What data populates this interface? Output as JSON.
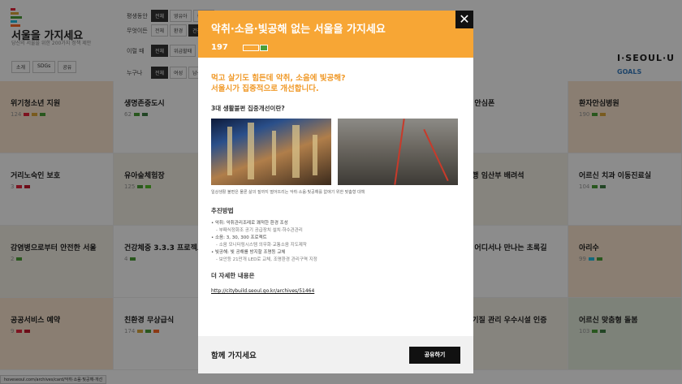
{
  "sidebar": {
    "title": "서울을 가지세요",
    "subtitle": "당신의 서울을 위한 200가지 정책 제안",
    "buttons": [
      "소개",
      "SDGs",
      "공유"
    ]
  },
  "filters": {
    "rows": [
      {
        "label": "평생동안",
        "chips": [
          "전체",
          "영유아",
          "청소년"
        ]
      },
      {
        "label": "무엇이든",
        "chips": [
          "전체",
          "환경",
          "건강"
        ]
      },
      {
        "label": "이럴 때",
        "chips": [
          "전체",
          "위급할때"
        ]
      },
      {
        "label": "누구나",
        "chips": [
          "전체",
          "여성",
          "남성"
        ]
      }
    ]
  },
  "brand": {
    "logo": "I·SEOUL·U",
    "goals": "GOALS"
  },
  "grid_cards": [
    {
      "title": "위기청소년 지원",
      "num": "124"
    },
    {
      "title": "생명존중도시",
      "num": "62"
    },
    {
      "title": "의 안심폰",
      "num": ""
    },
    {
      "title": "환자안심병원",
      "num": "190"
    },
    {
      "title": "거리노숙인 보호",
      "num": "3"
    },
    {
      "title": "유아숲체험장",
      "num": "125"
    },
    {
      "title": "보행 임산부 배려석",
      "num": ""
    },
    {
      "title": "어르신 치과 이동진료실",
      "num": "104"
    },
    {
      "title": "감염병으로부터 안전한 서울",
      "num": "2"
    },
    {
      "title": "건강체중 3.3.3 프로젝트",
      "num": "4"
    },
    {
      "title": "이 어디서나 만나는 초록길",
      "num": ""
    },
    {
      "title": "아리수",
      "num": "99"
    },
    {
      "title": "공공서비스 예약",
      "num": "9"
    },
    {
      "title": "친환경 무상급식",
      "num": "174"
    },
    {
      "title": "공기질 관리 우수시설 인증",
      "num": ""
    },
    {
      "title": "어르신 맞춤형 돌봄",
      "num": "103"
    }
  ],
  "status_url": "hoveseoul.com/archives/card/악취·소음·빛공해-개선",
  "modal": {
    "title": "악취·소음·빛공해 없는 서울을 가지세요",
    "number": "197",
    "lead_line1": "먹고 살기도 힘든데 악취, 소음에 빛공해?",
    "lead_line2": "서울시가 집중적으로 개선합니다.",
    "section1": "3대 생활불편 집중개선이란?",
    "caption": "일상생활 불편은 물론 삶의 질까지 떨어뜨리는 악취·소음·빛공해를 없애기 위한 맞춤형 대책",
    "section2": "추진방법",
    "methods": [
      {
        "item": "• 악취: 악취관리조례로 쾌적한 환경 조성",
        "sub": "- 부패식정화조 공기 공급장치 설치·하수관관리"
      },
      {
        "item": "• 소음: 3, 30, 300 프로젝트",
        "sub": "- 소음 모니터링시스템 의무화·교통소음 지도제작"
      },
      {
        "item": "• 빛공해: 빛 공해를 방지할 조명등 교체",
        "sub": "- 보안등 21만개 LED로 교체, 조명환경 관리구역 지정"
      }
    ],
    "more_label": "더 자세한 내용은",
    "link": "http://citybuild.seoul.go.kr/archives/51464",
    "footer_label": "함께 가지세요",
    "share_label": "공유하기",
    "close_symbol": "✕"
  },
  "colors": {
    "accent": "#f7a635",
    "lead": "#f09a2a",
    "dark": "#111111"
  }
}
